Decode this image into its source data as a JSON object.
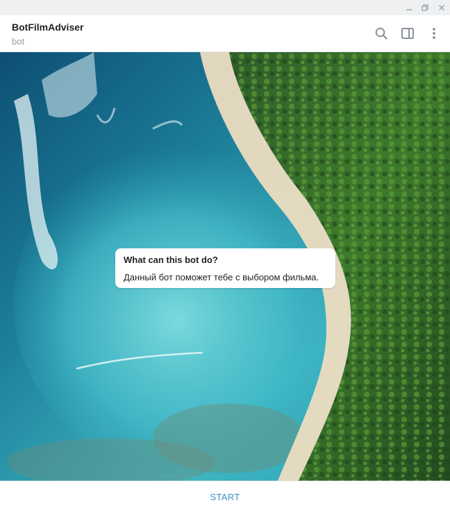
{
  "window": {
    "minimize_icon": "minimize-icon",
    "maximize_icon": "restore-icon",
    "close_icon": "close-icon"
  },
  "header": {
    "title": "BotFilmAdviser",
    "status": "bot",
    "actions": [
      "search-icon",
      "sidebar-toggle-icon",
      "more-vertical-icon"
    ]
  },
  "bot_info": {
    "heading": "What can this bot do?",
    "description": "Данный бот поможет тебе с выбором фильма."
  },
  "footer": {
    "start_label": "START"
  },
  "colors": {
    "accent": "#3a8fc4",
    "titlebar": "#eef0f2"
  }
}
